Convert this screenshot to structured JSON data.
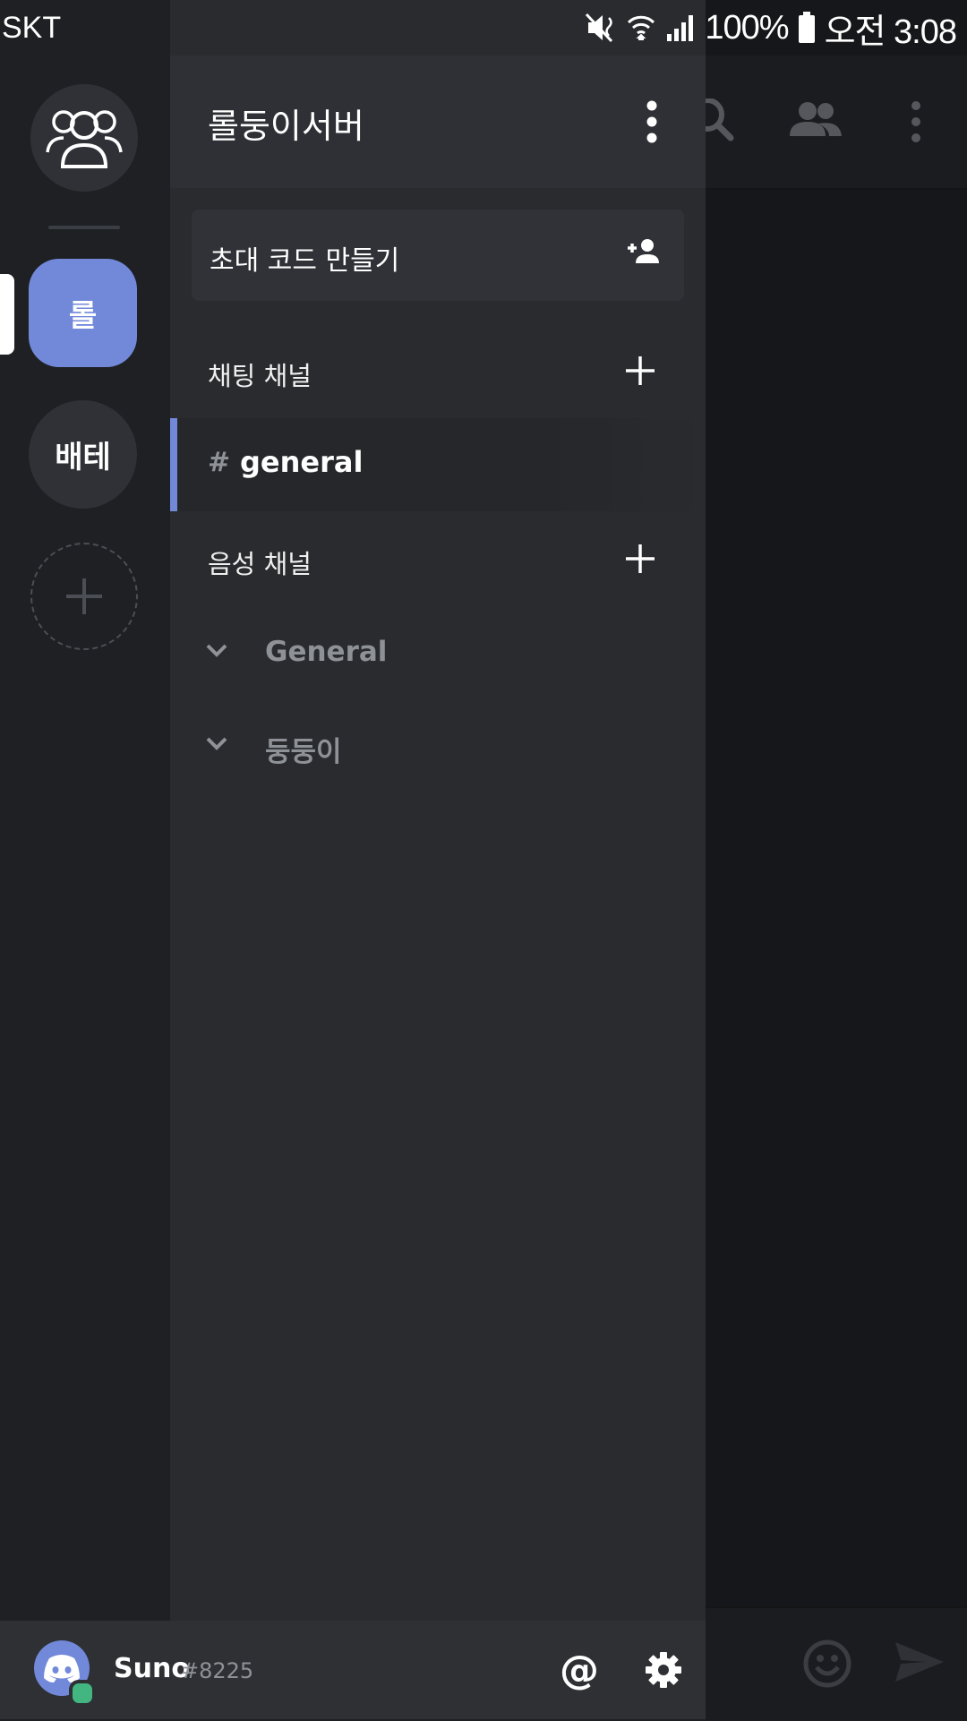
{
  "status_bar": {
    "carrier": "SKT",
    "battery": "100%",
    "time": "오전 3:08",
    "icons": [
      "mute-vibrate-icon",
      "wifi-icon",
      "signal-icon",
      "battery-icon"
    ]
  },
  "server_rail": {
    "home_icon": "friends-icon",
    "servers": [
      {
        "label": "롤",
        "active": true
      },
      {
        "label": "배테",
        "active": false
      }
    ],
    "add_icon": "plus-icon"
  },
  "drawer": {
    "server_name": "롤둥이서버",
    "invite_label": "초대 코드 만들기",
    "text_category": "채팅 채널",
    "text_channels": [
      {
        "hash": "#",
        "name": "general",
        "selected": true
      }
    ],
    "voice_category": "음성 채널",
    "voice_channels": [
      {
        "name": "General"
      },
      {
        "name": "둥둥이"
      }
    ]
  },
  "user_panel": {
    "username": "Suno",
    "discriminator": "#8225",
    "mention_symbol": "@",
    "status_color": "#43b581"
  },
  "colors": {
    "accent": "#7289da",
    "online": "#43b581"
  }
}
